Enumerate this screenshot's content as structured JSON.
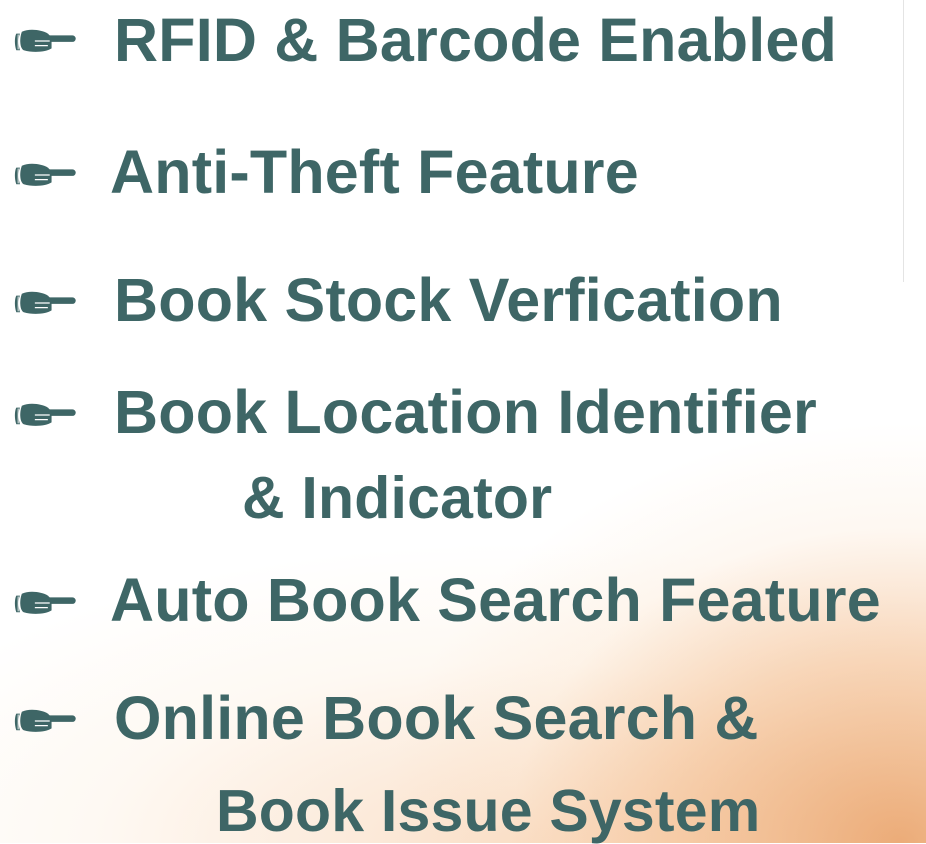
{
  "colors": {
    "text": "#3e6666",
    "bullet": "#3e6666",
    "glow": "#e48c46"
  },
  "bullet_icon": "pointing-hand-icon",
  "features": [
    {
      "line1": "RFID & Barcode Enabled"
    },
    {
      "line1": "Anti-Theft Feature"
    },
    {
      "line1": "Book Stock Verfication"
    },
    {
      "line1": "Book Location Identifier",
      "line2": "& Indicator"
    },
    {
      "line1": "Auto Book Search Feature"
    },
    {
      "line1": "Online Book Search &",
      "line2": "Book Issue System"
    }
  ]
}
